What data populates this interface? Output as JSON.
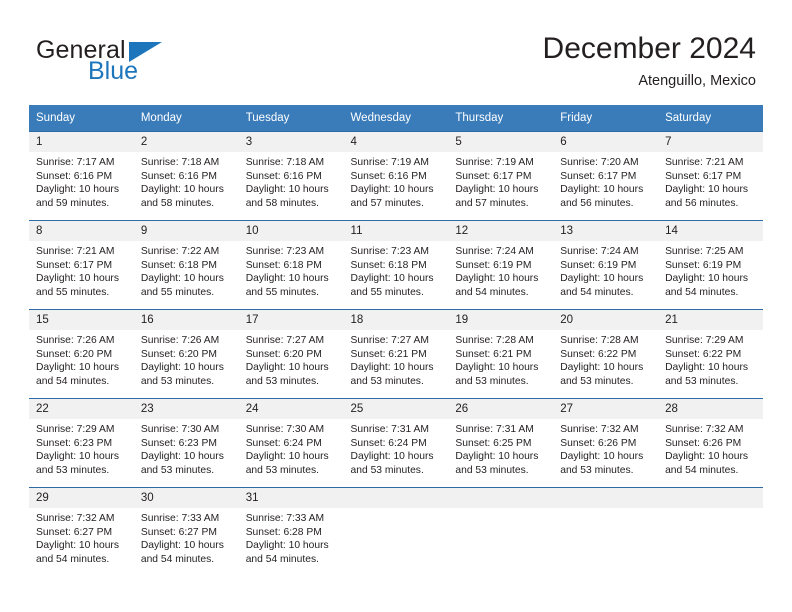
{
  "logo": {
    "word_one": "General",
    "word_two": "Blue",
    "triangle_color": "#1d76bc",
    "blue_text_color": "#1d76bc"
  },
  "header": {
    "title": "December 2024",
    "location": "Atenguillo, Mexico"
  },
  "theme": {
    "header_blue": "#3a7cba",
    "grid_line": "#2f6ca6",
    "daynum_band": "#f1f1f1",
    "text": "#231f20"
  },
  "weekday_headers": [
    "Sunday",
    "Monday",
    "Tuesday",
    "Wednesday",
    "Thursday",
    "Friday",
    "Saturday"
  ],
  "weeks": [
    [
      {
        "day": "1",
        "sunrise": "Sunrise: 7:17 AM",
        "sunset": "Sunset: 6:16 PM",
        "daylight_1": "Daylight: 10 hours",
        "daylight_2": "and 59 minutes."
      },
      {
        "day": "2",
        "sunrise": "Sunrise: 7:18 AM",
        "sunset": "Sunset: 6:16 PM",
        "daylight_1": "Daylight: 10 hours",
        "daylight_2": "and 58 minutes."
      },
      {
        "day": "3",
        "sunrise": "Sunrise: 7:18 AM",
        "sunset": "Sunset: 6:16 PM",
        "daylight_1": "Daylight: 10 hours",
        "daylight_2": "and 58 minutes."
      },
      {
        "day": "4",
        "sunrise": "Sunrise: 7:19 AM",
        "sunset": "Sunset: 6:16 PM",
        "daylight_1": "Daylight: 10 hours",
        "daylight_2": "and 57 minutes."
      },
      {
        "day": "5",
        "sunrise": "Sunrise: 7:19 AM",
        "sunset": "Sunset: 6:17 PM",
        "daylight_1": "Daylight: 10 hours",
        "daylight_2": "and 57 minutes."
      },
      {
        "day": "6",
        "sunrise": "Sunrise: 7:20 AM",
        "sunset": "Sunset: 6:17 PM",
        "daylight_1": "Daylight: 10 hours",
        "daylight_2": "and 56 minutes."
      },
      {
        "day": "7",
        "sunrise": "Sunrise: 7:21 AM",
        "sunset": "Sunset: 6:17 PM",
        "daylight_1": "Daylight: 10 hours",
        "daylight_2": "and 56 minutes."
      }
    ],
    [
      {
        "day": "8",
        "sunrise": "Sunrise: 7:21 AM",
        "sunset": "Sunset: 6:17 PM",
        "daylight_1": "Daylight: 10 hours",
        "daylight_2": "and 55 minutes."
      },
      {
        "day": "9",
        "sunrise": "Sunrise: 7:22 AM",
        "sunset": "Sunset: 6:18 PM",
        "daylight_1": "Daylight: 10 hours",
        "daylight_2": "and 55 minutes."
      },
      {
        "day": "10",
        "sunrise": "Sunrise: 7:23 AM",
        "sunset": "Sunset: 6:18 PM",
        "daylight_1": "Daylight: 10 hours",
        "daylight_2": "and 55 minutes."
      },
      {
        "day": "11",
        "sunrise": "Sunrise: 7:23 AM",
        "sunset": "Sunset: 6:18 PM",
        "daylight_1": "Daylight: 10 hours",
        "daylight_2": "and 55 minutes."
      },
      {
        "day": "12",
        "sunrise": "Sunrise: 7:24 AM",
        "sunset": "Sunset: 6:19 PM",
        "daylight_1": "Daylight: 10 hours",
        "daylight_2": "and 54 minutes."
      },
      {
        "day": "13",
        "sunrise": "Sunrise: 7:24 AM",
        "sunset": "Sunset: 6:19 PM",
        "daylight_1": "Daylight: 10 hours",
        "daylight_2": "and 54 minutes."
      },
      {
        "day": "14",
        "sunrise": "Sunrise: 7:25 AM",
        "sunset": "Sunset: 6:19 PM",
        "daylight_1": "Daylight: 10 hours",
        "daylight_2": "and 54 minutes."
      }
    ],
    [
      {
        "day": "15",
        "sunrise": "Sunrise: 7:26 AM",
        "sunset": "Sunset: 6:20 PM",
        "daylight_1": "Daylight: 10 hours",
        "daylight_2": "and 54 minutes."
      },
      {
        "day": "16",
        "sunrise": "Sunrise: 7:26 AM",
        "sunset": "Sunset: 6:20 PM",
        "daylight_1": "Daylight: 10 hours",
        "daylight_2": "and 53 minutes."
      },
      {
        "day": "17",
        "sunrise": "Sunrise: 7:27 AM",
        "sunset": "Sunset: 6:20 PM",
        "daylight_1": "Daylight: 10 hours",
        "daylight_2": "and 53 minutes."
      },
      {
        "day": "18",
        "sunrise": "Sunrise: 7:27 AM",
        "sunset": "Sunset: 6:21 PM",
        "daylight_1": "Daylight: 10 hours",
        "daylight_2": "and 53 minutes."
      },
      {
        "day": "19",
        "sunrise": "Sunrise: 7:28 AM",
        "sunset": "Sunset: 6:21 PM",
        "daylight_1": "Daylight: 10 hours",
        "daylight_2": "and 53 minutes."
      },
      {
        "day": "20",
        "sunrise": "Sunrise: 7:28 AM",
        "sunset": "Sunset: 6:22 PM",
        "daylight_1": "Daylight: 10 hours",
        "daylight_2": "and 53 minutes."
      },
      {
        "day": "21",
        "sunrise": "Sunrise: 7:29 AM",
        "sunset": "Sunset: 6:22 PM",
        "daylight_1": "Daylight: 10 hours",
        "daylight_2": "and 53 minutes."
      }
    ],
    [
      {
        "day": "22",
        "sunrise": "Sunrise: 7:29 AM",
        "sunset": "Sunset: 6:23 PM",
        "daylight_1": "Daylight: 10 hours",
        "daylight_2": "and 53 minutes."
      },
      {
        "day": "23",
        "sunrise": "Sunrise: 7:30 AM",
        "sunset": "Sunset: 6:23 PM",
        "daylight_1": "Daylight: 10 hours",
        "daylight_2": "and 53 minutes."
      },
      {
        "day": "24",
        "sunrise": "Sunrise: 7:30 AM",
        "sunset": "Sunset: 6:24 PM",
        "daylight_1": "Daylight: 10 hours",
        "daylight_2": "and 53 minutes."
      },
      {
        "day": "25",
        "sunrise": "Sunrise: 7:31 AM",
        "sunset": "Sunset: 6:24 PM",
        "daylight_1": "Daylight: 10 hours",
        "daylight_2": "and 53 minutes."
      },
      {
        "day": "26",
        "sunrise": "Sunrise: 7:31 AM",
        "sunset": "Sunset: 6:25 PM",
        "daylight_1": "Daylight: 10 hours",
        "daylight_2": "and 53 minutes."
      },
      {
        "day": "27",
        "sunrise": "Sunrise: 7:32 AM",
        "sunset": "Sunset: 6:26 PM",
        "daylight_1": "Daylight: 10 hours",
        "daylight_2": "and 53 minutes."
      },
      {
        "day": "28",
        "sunrise": "Sunrise: 7:32 AM",
        "sunset": "Sunset: 6:26 PM",
        "daylight_1": "Daylight: 10 hours",
        "daylight_2": "and 54 minutes."
      }
    ],
    [
      {
        "day": "29",
        "sunrise": "Sunrise: 7:32 AM",
        "sunset": "Sunset: 6:27 PM",
        "daylight_1": "Daylight: 10 hours",
        "daylight_2": "and 54 minutes."
      },
      {
        "day": "30",
        "sunrise": "Sunrise: 7:33 AM",
        "sunset": "Sunset: 6:27 PM",
        "daylight_1": "Daylight: 10 hours",
        "daylight_2": "and 54 minutes."
      },
      {
        "day": "31",
        "sunrise": "Sunrise: 7:33 AM",
        "sunset": "Sunset: 6:28 PM",
        "daylight_1": "Daylight: 10 hours",
        "daylight_2": "and 54 minutes."
      },
      {
        "day": "",
        "sunrise": "",
        "sunset": "",
        "daylight_1": "",
        "daylight_2": ""
      },
      {
        "day": "",
        "sunrise": "",
        "sunset": "",
        "daylight_1": "",
        "daylight_2": ""
      },
      {
        "day": "",
        "sunrise": "",
        "sunset": "",
        "daylight_1": "",
        "daylight_2": ""
      },
      {
        "day": "",
        "sunrise": "",
        "sunset": "",
        "daylight_1": "",
        "daylight_2": ""
      }
    ]
  ]
}
